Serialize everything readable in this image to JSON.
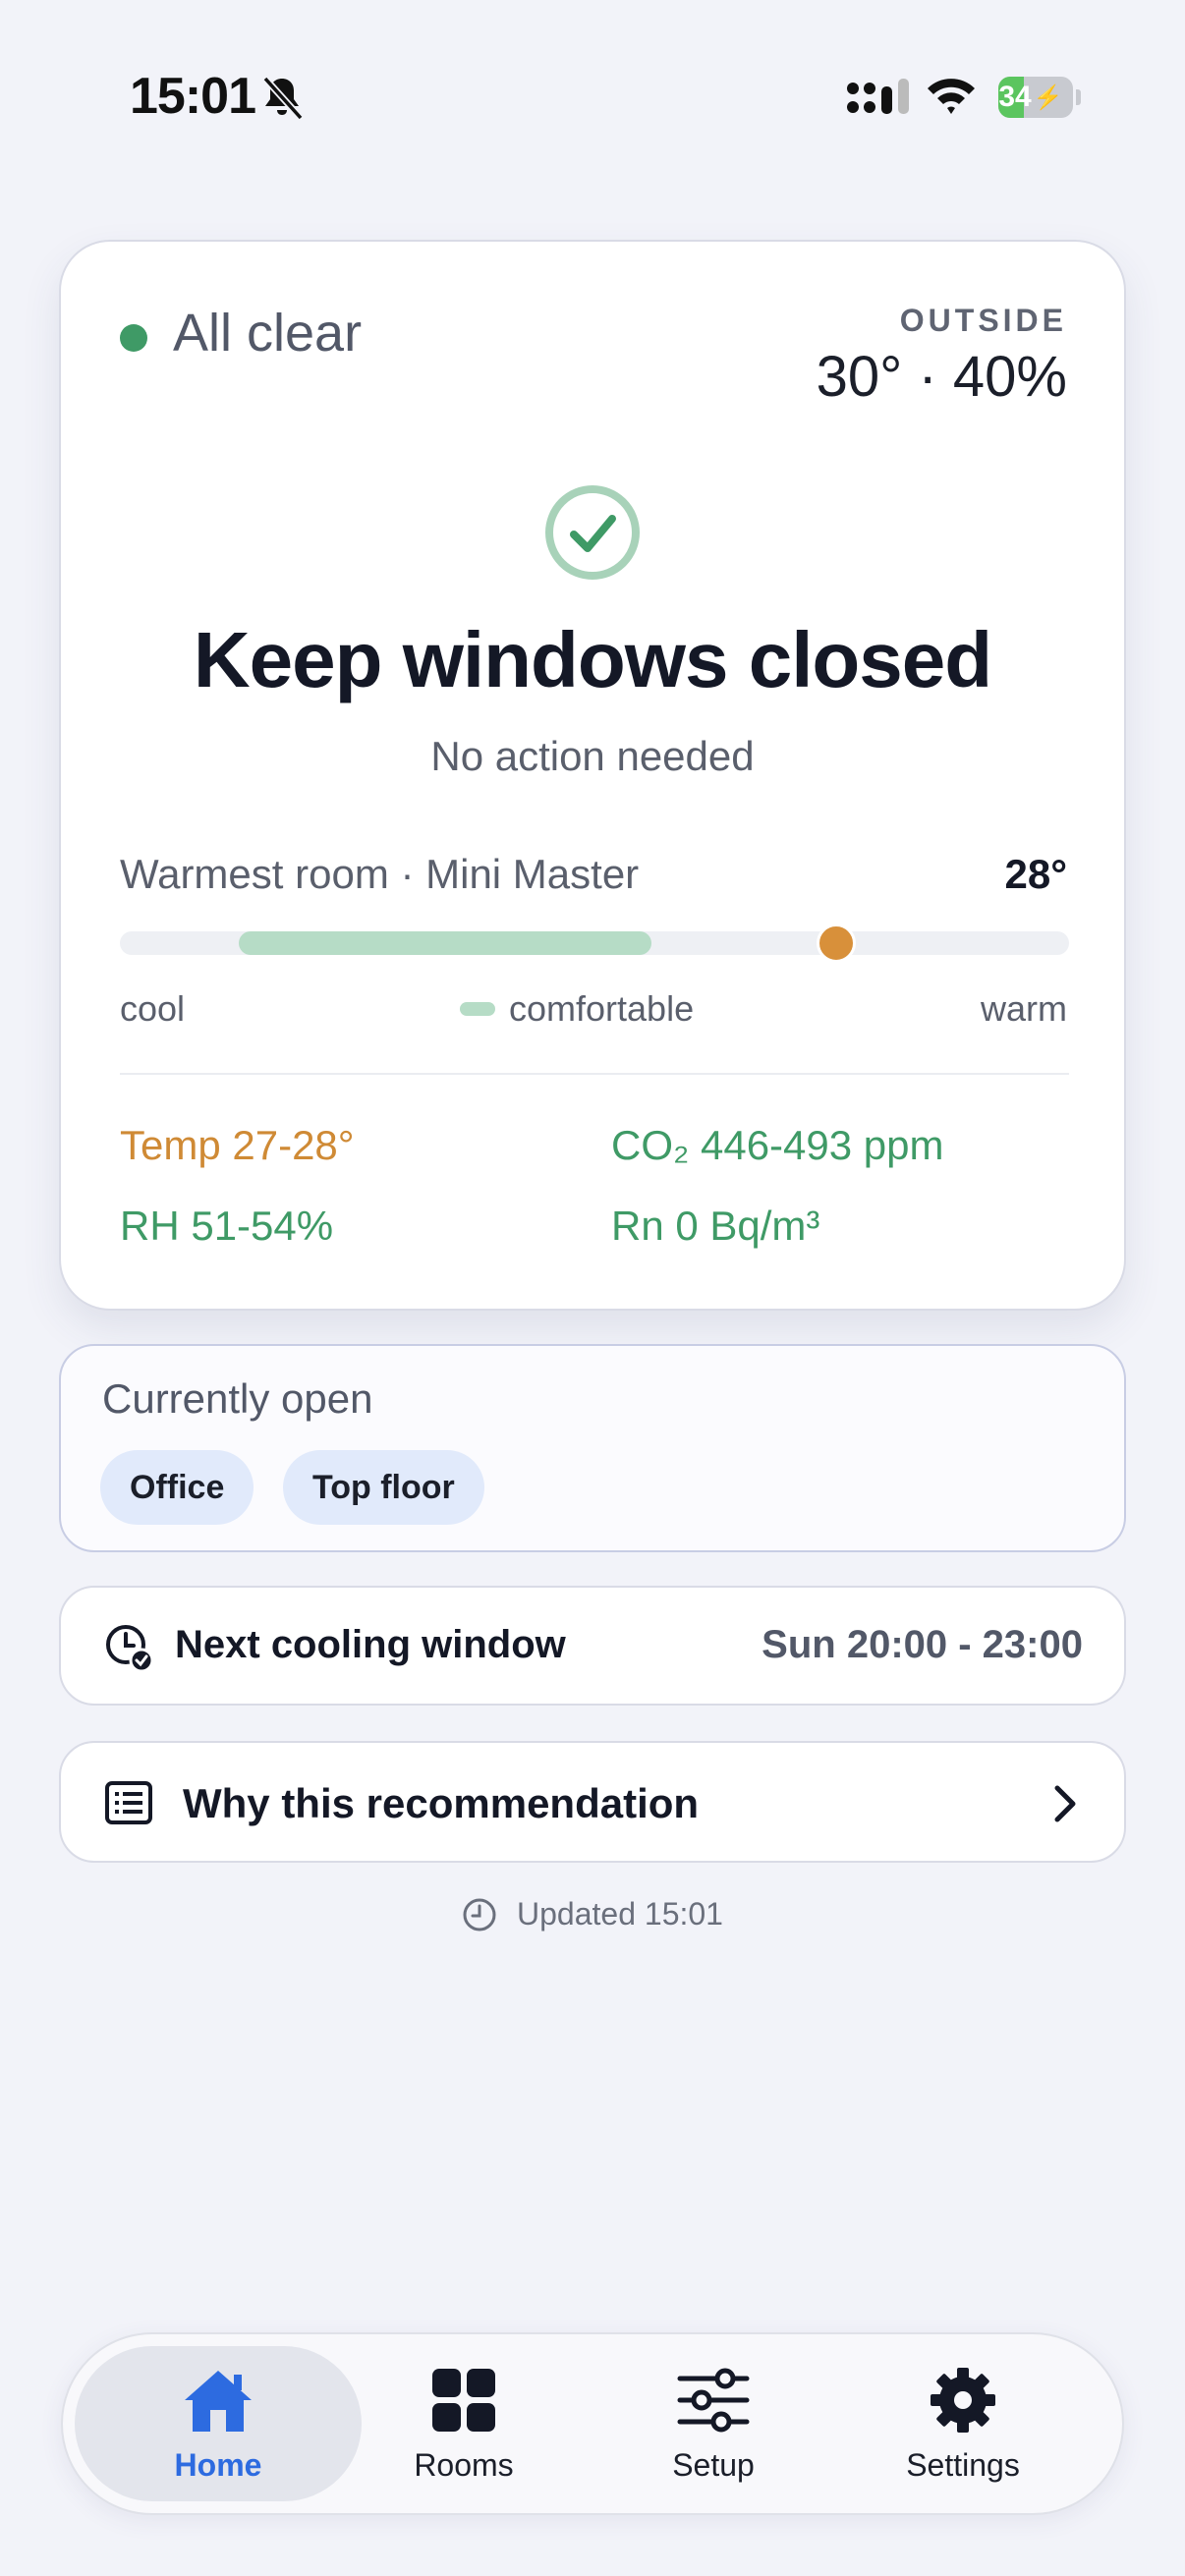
{
  "status_bar": {
    "time": "15:01",
    "battery_percent": "34",
    "battery_level": 0.34
  },
  "summary": {
    "status": "All clear",
    "status_color": "#3f9a66",
    "outside_label": "OUTSIDE",
    "outside_value": "30° · 40%",
    "headline": "Keep windows closed",
    "subline": "No action needed",
    "warmest_label": "Warmest room · Mini Master",
    "warmest_value": "28°",
    "scale": {
      "cool": "cool",
      "comfortable": "comfortable",
      "warm": "warm",
      "comfort_start": 0.125,
      "comfort_end": 0.56,
      "marker_position": 0.755
    },
    "metrics": {
      "temp": "Temp 27-28°",
      "co2": "CO₂ 446-493 ppm",
      "rh": "RH 51-54%",
      "rn": "Rn 0 Bq/m³"
    },
    "colors": {
      "ok": "#3f9a66",
      "warn": "#cf8a35",
      "comfort": "#b6dcc6"
    }
  },
  "open": {
    "title": "Currently open",
    "rooms": [
      "Office",
      "Top floor"
    ]
  },
  "cooling": {
    "label": "Next cooling window",
    "value": "Sun 20:00 - 23:00"
  },
  "why": {
    "label": "Why this recommendation"
  },
  "updated": "Updated 15:01",
  "tabs": [
    {
      "label": "Home",
      "icon": "home-icon",
      "active": true
    },
    {
      "label": "Rooms",
      "icon": "grid-icon",
      "active": false
    },
    {
      "label": "Setup",
      "icon": "sliders-icon",
      "active": false
    },
    {
      "label": "Settings",
      "icon": "gear-icon",
      "active": false
    }
  ],
  "accent_color": "#2d6be0"
}
